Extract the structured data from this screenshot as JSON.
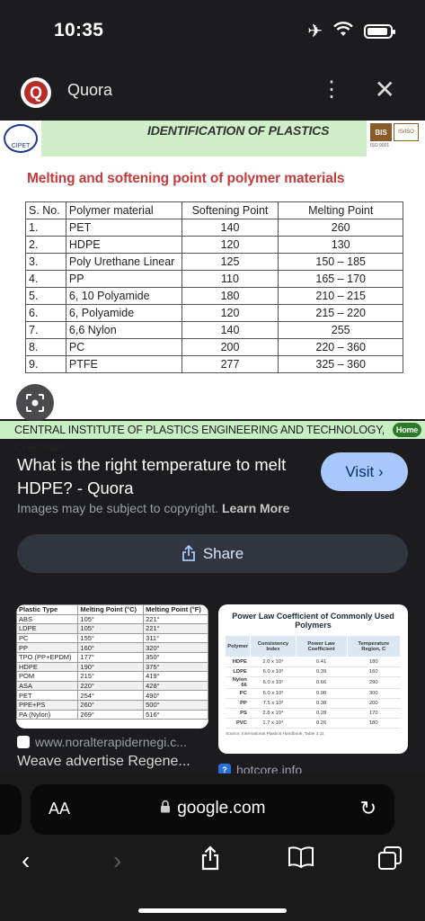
{
  "status_bar": {
    "time": "10:35"
  },
  "header": {
    "site_name": "Quora",
    "logo_letter": "Q"
  },
  "image": {
    "banner_title": "IDENTIFICATION OF PLASTICS",
    "cipet_seal_text": "CIPET",
    "bis_mark_text": "BIS",
    "bis_mark2_text": "IS/ISO",
    "iso_text": "ISO 9001",
    "heading": "Melting and softening point of polymer materials",
    "table": {
      "headers": [
        "S. No.",
        "Polymer material",
        "Softening Point",
        "Melting Point"
      ],
      "rows": [
        [
          "1.",
          "PET",
          "140",
          "260"
        ],
        [
          "2.",
          "HDPE",
          "120",
          "130"
        ],
        [
          "3.",
          "Poly Urethane Linear",
          "125",
          "150 – 185"
        ],
        [
          "4.",
          "PP",
          "110",
          "165 – 170"
        ],
        [
          "5.",
          "6, 10 Polyamide",
          "180",
          "210 – 215"
        ],
        [
          "6.",
          "6, Polyamide",
          "120",
          "215 – 220"
        ],
        [
          "7.",
          "6,6 Nylon",
          "140",
          "255"
        ],
        [
          "8.",
          "PC",
          "200",
          "220 – 360"
        ],
        [
          "9.",
          "PTFE",
          "277",
          "325 – 360"
        ]
      ]
    },
    "footer_strip": "CENTRAL INSTITUTE OF PLASTICS ENGINEERING AND TECHNOLOGY, CHENNAI",
    "home_badge": "Home"
  },
  "result": {
    "title": "What is the right temperature to melt HDPE? - Quora",
    "visit_label": "Visit",
    "visit_chevron": "›",
    "copyright_text": "Images may be subject to copyright.",
    "learn_more": "Learn More",
    "share_label": "Share"
  },
  "related": [
    {
      "domain": "www.noralterapidernegi.c...",
      "title": "Weave advertise Regene...",
      "table": {
        "headers": [
          "Plastic Type",
          "Melting Point (°C)",
          "Melting Point (°F)"
        ],
        "rows": [
          [
            "ABS",
            "105°",
            "221°"
          ],
          [
            "LDPE",
            "105°",
            "221°"
          ],
          [
            "PC",
            "155°",
            "311°"
          ],
          [
            "PP",
            "160°",
            "320°"
          ],
          [
            "TPO (PP+EPDM)",
            "177°",
            "350°"
          ],
          [
            "HDPE",
            "190°",
            "375°"
          ],
          [
            "POM",
            "215°",
            "419°"
          ],
          [
            "ASA",
            "220°",
            "428°"
          ],
          [
            "PET",
            "254°",
            "490°"
          ],
          [
            "PPE+PS",
            "260°",
            "500°"
          ],
          [
            "PA (Nylon)",
            "269°",
            "516°"
          ]
        ]
      }
    },
    {
      "domain": "hotcore.info",
      "favicon_glyph": "?",
      "table_title": "Power Law Coefficient of Commonly Used Polymers",
      "table": {
        "headers": [
          "Polymer",
          "Consistency Index",
          "Power Law Coefficient",
          "Temperature Region, C"
        ],
        "rows": [
          [
            "HDPE",
            "2.0 x 10⁴",
            "0.41",
            "180"
          ],
          [
            "LDPE",
            "6.0 x 10³",
            "0.39",
            "160"
          ],
          [
            "Nylon 66",
            "6.0 x 10²",
            "0.66",
            "290"
          ],
          [
            "PC",
            "6.0 x 10³",
            "0.98",
            "300"
          ],
          [
            "PP",
            "7.5 x 10³",
            "0.38",
            "200"
          ],
          [
            "PS",
            "2.8 x 10⁴",
            "0.28",
            "170"
          ],
          [
            "PVC",
            "1.7 x 10⁴",
            "0.26",
            "180"
          ]
        ]
      },
      "source": "Source: International Plastics Handbook, Table 3.11"
    }
  ],
  "browser": {
    "aa_label": "AA",
    "url": "google.com"
  },
  "icons": {
    "more": "⋮",
    "close": "✕",
    "share": "⇪",
    "back": "‹",
    "forward": "›",
    "lock": "🔒",
    "reload": "↻",
    "bookmarks": "📖",
    "tabs": "⧉",
    "lens": "⌕"
  }
}
